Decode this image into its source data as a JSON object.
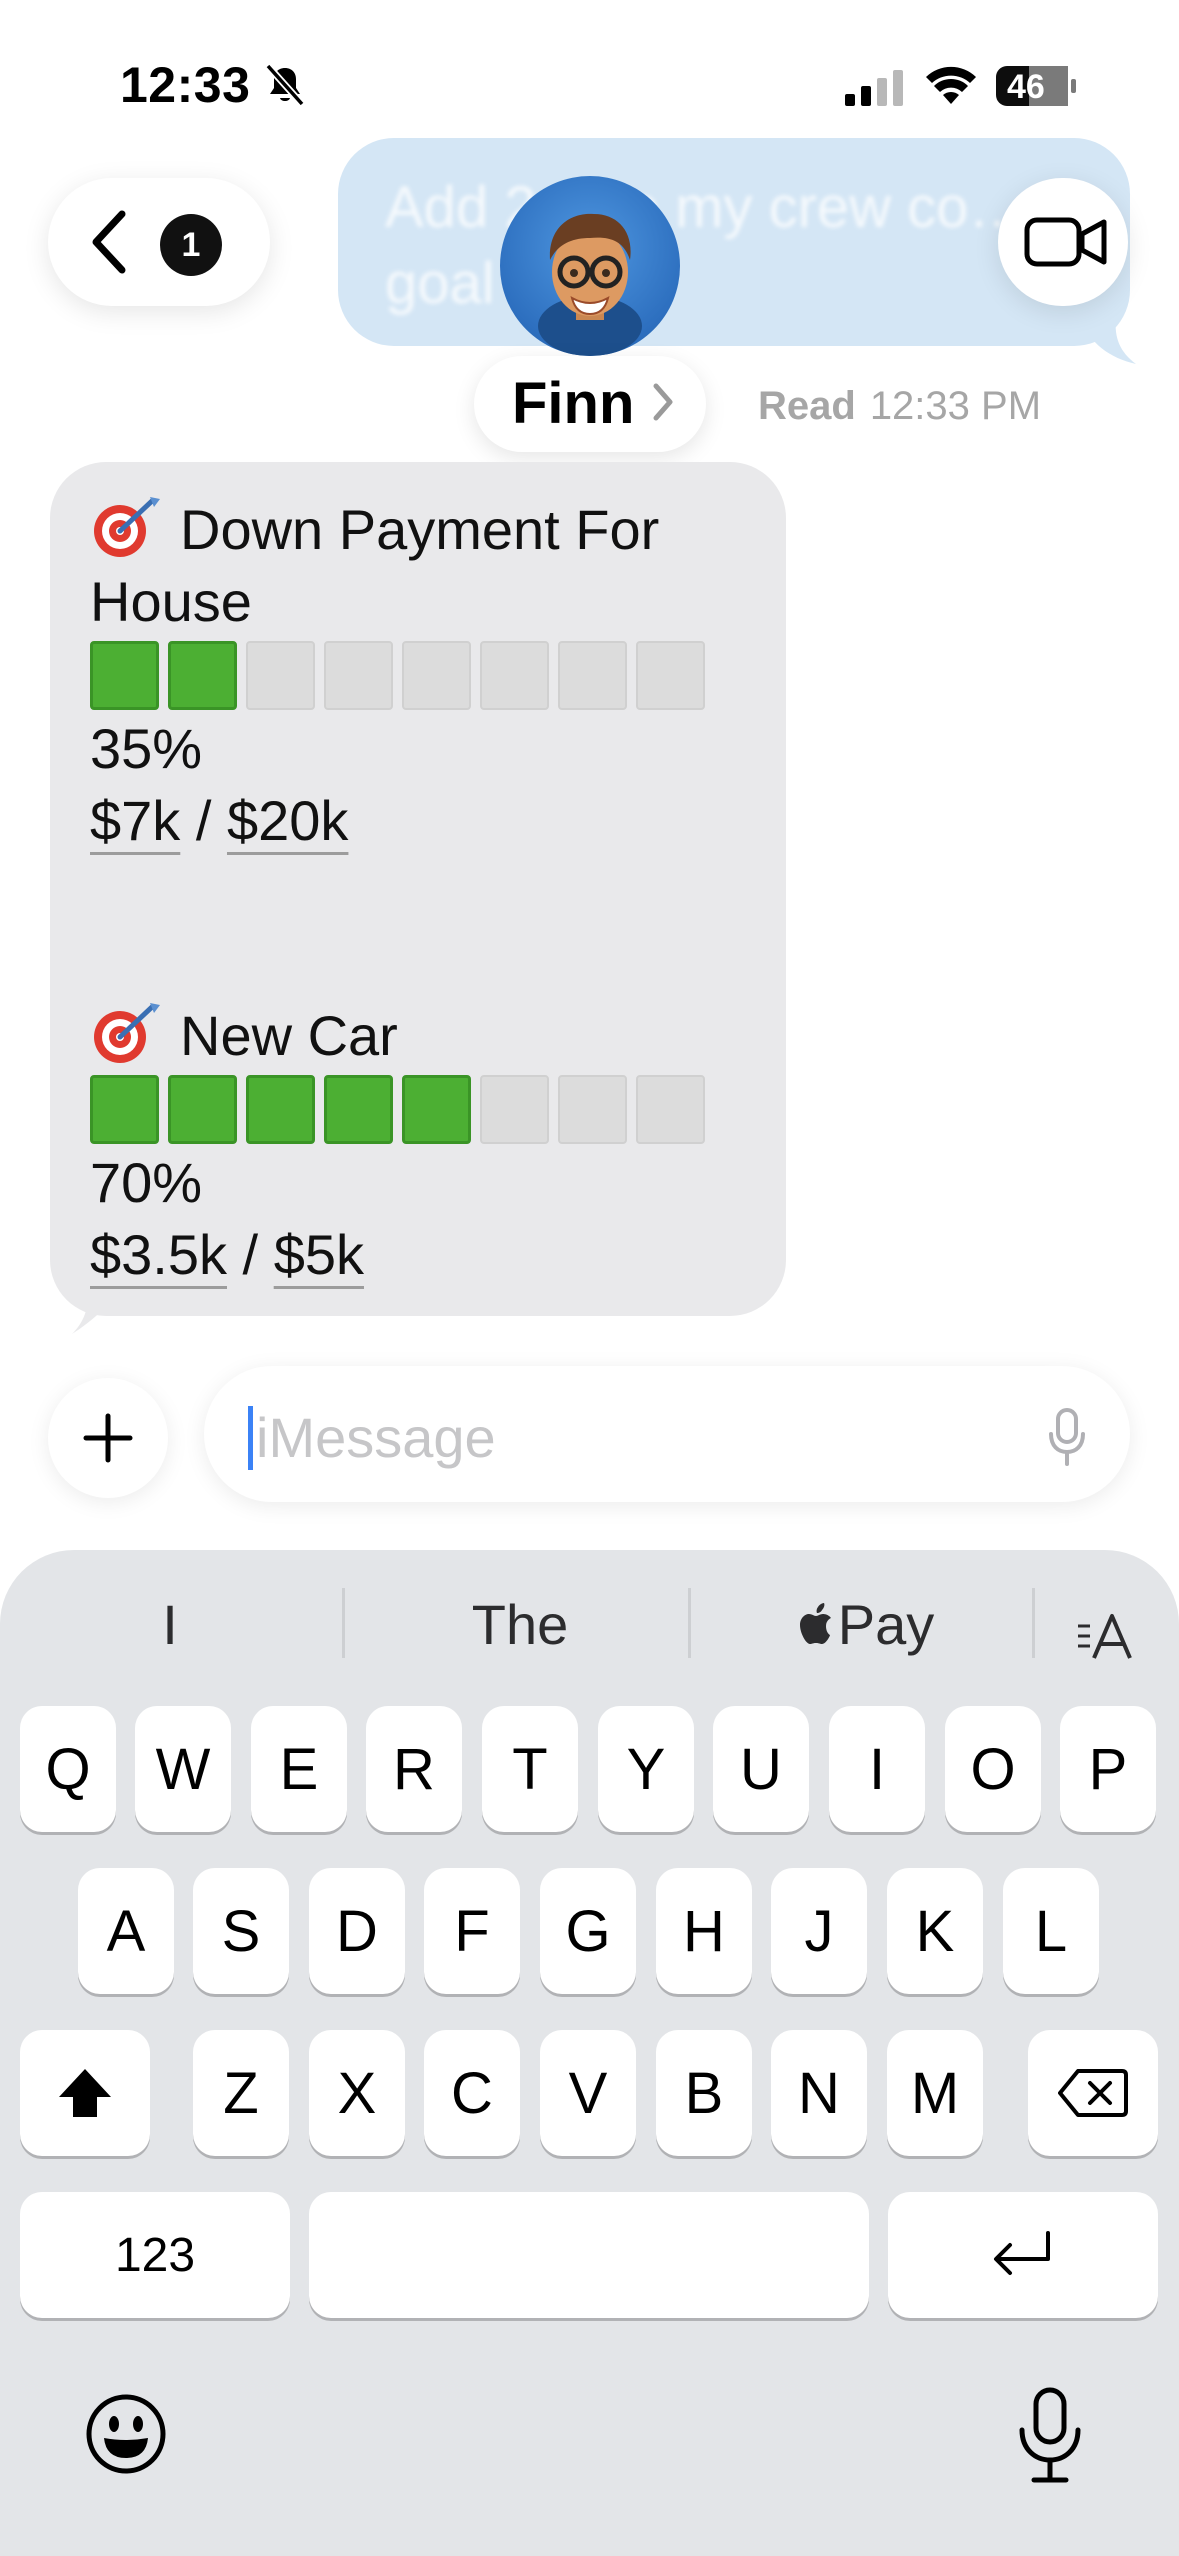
{
  "status_bar": {
    "time": "12:33",
    "battery": "46",
    "icons": [
      "bell-slash-icon",
      "signal-icon",
      "wifi-icon",
      "battery-icon"
    ]
  },
  "nav": {
    "back_badge": "1",
    "contact_name": "Finn",
    "video_icon": "video-camera-icon"
  },
  "sent_message": {
    "text": "Add 2… to my crew co… goal",
    "receipt_label": "Read",
    "receipt_time": "12:33 PM"
  },
  "received_message": {
    "goals": [
      {
        "icon": "dart-target-icon",
        "title_line1": "Down Payment For",
        "title_line2": "House",
        "filled_segments": 2,
        "total_segments": 8,
        "percent": "35%",
        "saved": "$7k",
        "separator": " / ",
        "target": "$20k",
        "progress": 0.35
      },
      {
        "icon": "dart-target-icon",
        "title_line1": "New Car",
        "title_line2": "",
        "filled_segments": 5,
        "total_segments": 8,
        "percent": "70%",
        "saved": "$3.5k",
        "separator": " / ",
        "target": "$5k",
        "progress": 0.7
      }
    ]
  },
  "composer": {
    "placeholder": "iMessage",
    "plus_icon": "plus-icon",
    "mic_icon": "microphone-icon"
  },
  "keyboard": {
    "suggestions": [
      "I",
      "The",
      "Pay"
    ],
    "apple_pay_prefix": "",
    "row1": [
      "Q",
      "W",
      "E",
      "R",
      "T",
      "Y",
      "U",
      "I",
      "O",
      "P"
    ],
    "row2": [
      "A",
      "S",
      "D",
      "F",
      "G",
      "H",
      "J",
      "K",
      "L"
    ],
    "row3": [
      "Z",
      "X",
      "C",
      "V",
      "B",
      "N",
      "M"
    ],
    "numbers_label": "123",
    "text_style_icon": "text-size-icon",
    "shift_icon": "shift-icon",
    "delete_icon": "delete-icon",
    "return_icon": "return-icon",
    "emoji_icon": "emoji-icon",
    "dictation_icon": "microphone-icon"
  },
  "colors": {
    "progress_fill": "#4caf33",
    "progress_empty": "#dcdcdc",
    "received_bubble": "#e9e9eb",
    "sent_bubble": "#d4e6f5",
    "keyboard_bg": "#e3e5e8"
  }
}
